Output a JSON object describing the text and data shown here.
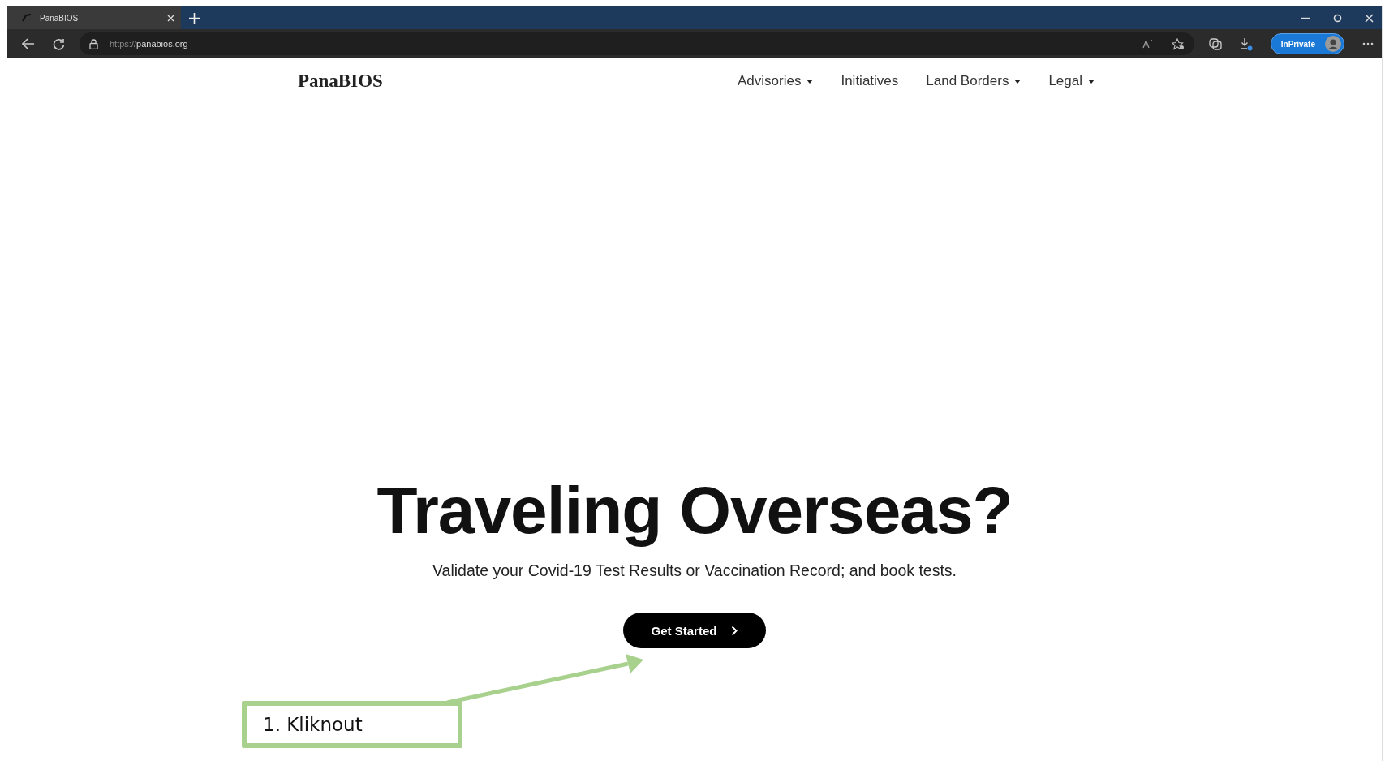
{
  "browser": {
    "tab": {
      "title": "PanaBIOS",
      "selected": true
    },
    "address": {
      "scheme": "https://",
      "host": "panabios.org"
    },
    "profile_label": "InPrivate"
  },
  "site": {
    "logo": "PanaBIOS",
    "nav": [
      {
        "label": "Advisories",
        "dropdown": true
      },
      {
        "label": "Initiatives",
        "dropdown": false
      },
      {
        "label": "Land Borders",
        "dropdown": true
      },
      {
        "label": "Legal",
        "dropdown": true
      }
    ]
  },
  "hero": {
    "heading": "Traveling Overseas?",
    "subtitle": "Validate your Covid-19 Test Results or Vaccination Record; and book tests.",
    "button": "Get Started"
  },
  "annotation": {
    "text": "1. Kliknout"
  }
}
